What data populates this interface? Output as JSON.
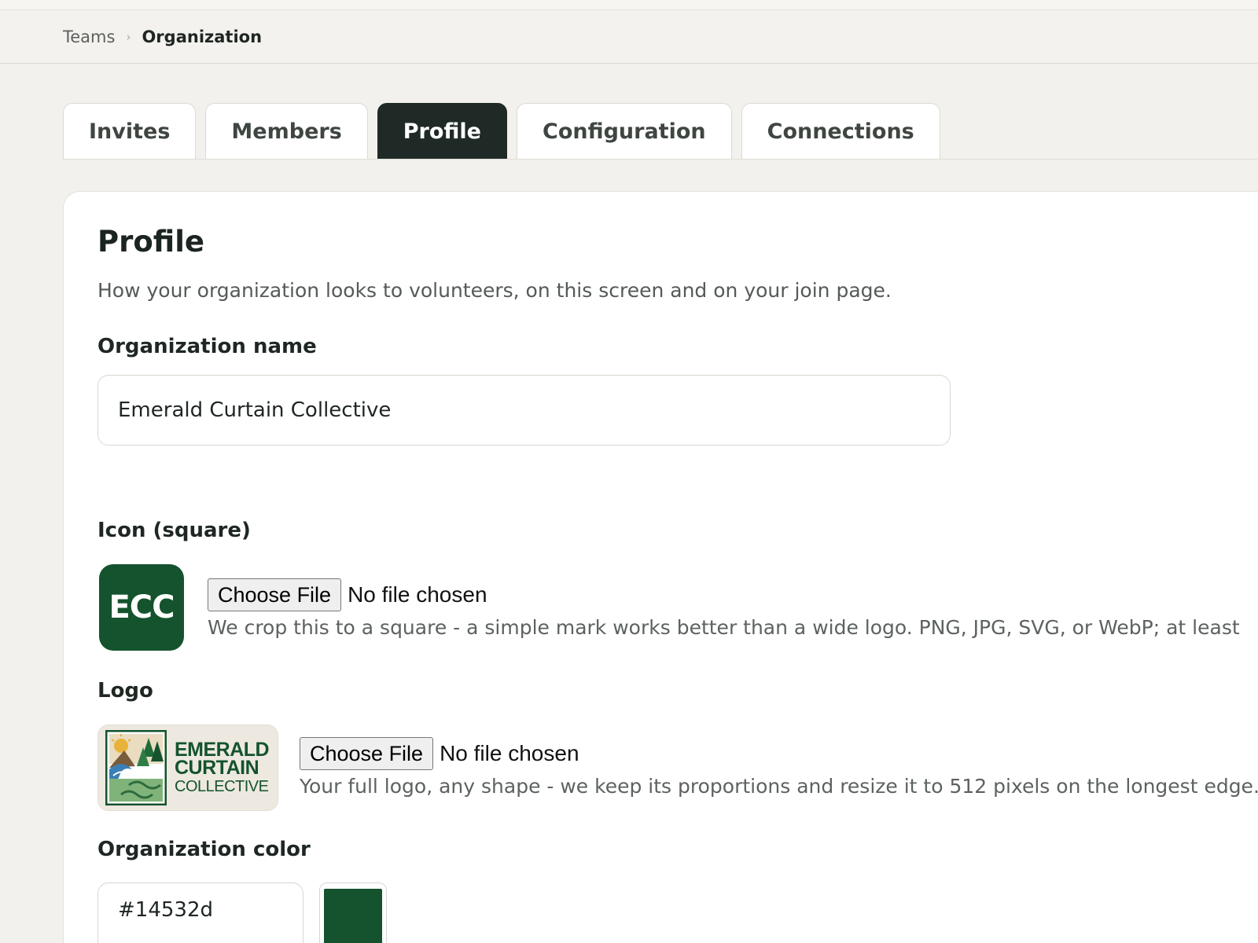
{
  "breadcrumb": {
    "parent": "Teams",
    "separator": "›",
    "current": "Organization"
  },
  "tabs": [
    {
      "label": "Invites",
      "active": false
    },
    {
      "label": "Members",
      "active": false
    },
    {
      "label": "Profile",
      "active": true
    },
    {
      "label": "Configuration",
      "active": false
    },
    {
      "label": "Connections",
      "active": false
    }
  ],
  "profile": {
    "title": "Profile",
    "description": "How your organization looks to volunteers, on this screen and on your join page.",
    "name_label": "Organization name",
    "name_value": "Emerald Curtain Collective",
    "icon_label": "Icon (square)",
    "icon_text": "ECC",
    "icon_choose": "Choose File",
    "icon_status": "No file chosen",
    "icon_hint": "We crop this to a square - a simple mark works better than a wide logo. PNG, JPG, SVG, or WebP; at least",
    "logo_label": "Logo",
    "logo_line1": "EMERALD",
    "logo_line2": "CURTAIN",
    "logo_line3": "COLLECTIVE",
    "logo_choose": "Choose File",
    "logo_status": "No file chosen",
    "logo_hint": "Your full logo, any shape - we keep its proportions and resize it to 512 pixels on the longest edge.",
    "color_label": "Organization color",
    "color_value": "#14532d"
  },
  "colors": {
    "brand": "#14532d",
    "tab_active_bg": "#1f2a26"
  }
}
